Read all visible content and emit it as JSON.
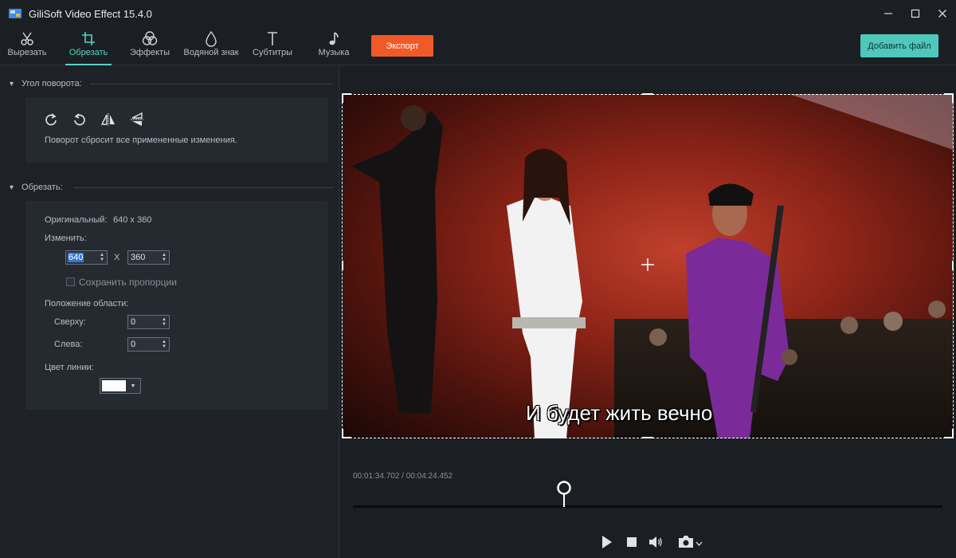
{
  "app": {
    "title": "GiliSoft Video Effect 15.4.0"
  },
  "window_controls": {
    "minimize": "—",
    "maximize": "☐",
    "close": "✕"
  },
  "toolbar": {
    "tools": [
      {
        "label": "Вырезать",
        "icon": "scissors-icon"
      },
      {
        "label": "Обрезать",
        "icon": "crop-icon",
        "active": true
      },
      {
        "label": "Эффекты",
        "icon": "effects-icon"
      },
      {
        "label": "Водяной знак",
        "icon": "watermark-icon"
      },
      {
        "label": "Субтитры",
        "icon": "text-icon"
      },
      {
        "label": "Музыка",
        "icon": "music-icon"
      }
    ],
    "export_label": "Экспорт",
    "add_file_label": "Добавить файл"
  },
  "rotation": {
    "title": "Угол поворота:",
    "note": "Поворот сбросит все примененные изменения.",
    "icons": [
      "rotate-cw-icon",
      "rotate-ccw-icon",
      "flip-horizontal-icon",
      "flip-vertical-icon"
    ]
  },
  "crop": {
    "title": "Обрезать:",
    "original_label": "Оригинальный:",
    "original_value": "640 x 360",
    "change_label": "Изменить:",
    "width": "640",
    "times": "X",
    "height": "360",
    "keep_ratio_label": "Сохранить пропорции",
    "keep_ratio_checked": false,
    "position_label": "Положение области:",
    "top_label": "Сверху:",
    "top_value": "0",
    "left_label": "Слева:",
    "left_value": "0",
    "line_color_label": "Цвет линии:",
    "line_color": "#ffffff"
  },
  "player": {
    "subtitle": "И будет жить вечно",
    "current_time": "00:01:34.702",
    "separator": " / ",
    "total_time": "00:04:24.452",
    "progress": 0.358
  },
  "colors": {
    "accent": "#56d3c4",
    "export": "#f05a28",
    "add_file": "#4fc7bb"
  }
}
